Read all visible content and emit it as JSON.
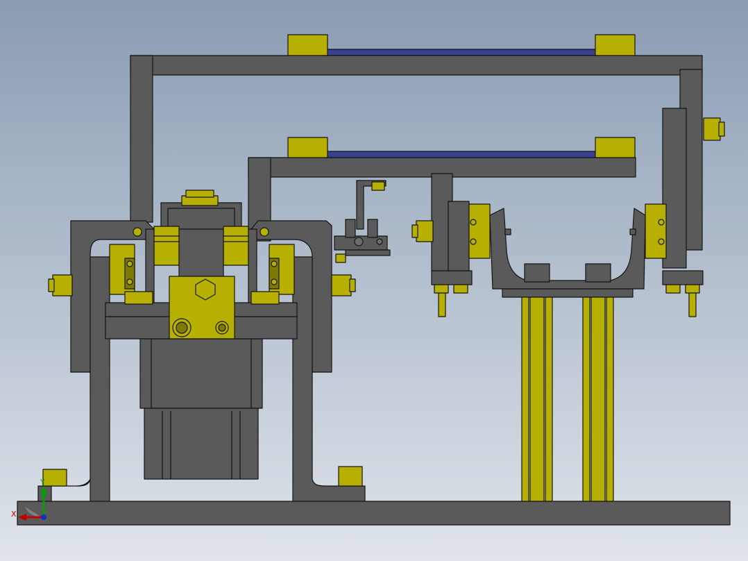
{
  "viewport": {
    "background_top": "#8a9cb3",
    "background_bottom": "#dfe4ea"
  },
  "colors": {
    "steel": "#5a5a5a",
    "steel_light": "#6b6b6b",
    "steel_dark": "#3a3a3a",
    "outline": "#141414",
    "brass": "#b8b000",
    "brass_dark": "#7e7a00",
    "rail_blue": "#3b3f8f",
    "axis_x": "#c00000",
    "axis_y": "#00a000",
    "axis_z": "#1030c0"
  },
  "triad": {
    "x_label": "X",
    "y_label": "Y",
    "x_icon": "axis-x-arrow",
    "y_icon": "axis-y-arrow",
    "z_icon": "axis-z-dot"
  }
}
